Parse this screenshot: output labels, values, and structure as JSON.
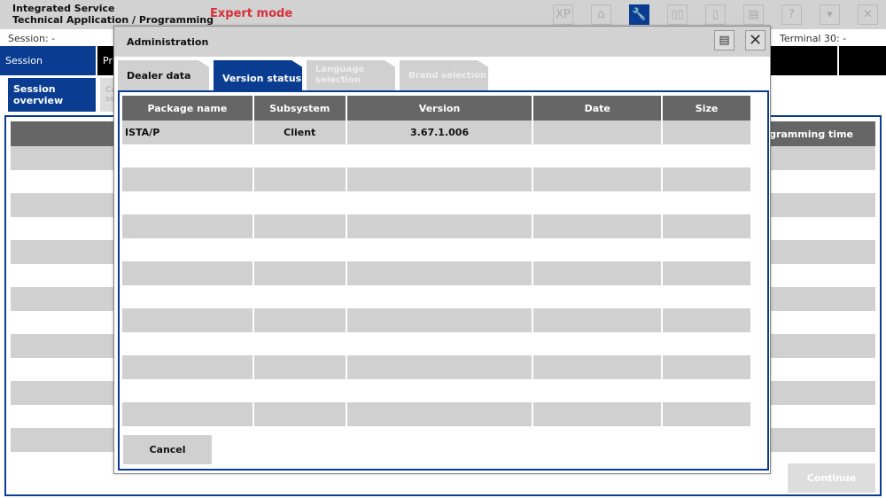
{
  "app": {
    "title_line1": "Integrated Service",
    "title_line2": "Technical Application / Programming",
    "mode": "Expert mode"
  },
  "toolbar": [
    {
      "icon": "xp-icon",
      "label": "XP"
    },
    {
      "icon": "home-icon",
      "label": "⌂"
    },
    {
      "icon": "wrench-icon",
      "label": "🔧"
    },
    {
      "icon": "compare-icon",
      "label": "▯▯"
    },
    {
      "icon": "battery-icon",
      "label": "▯"
    },
    {
      "icon": "printer-icon",
      "label": "▤"
    },
    {
      "icon": "help-icon",
      "label": "?"
    },
    {
      "icon": "minimize-icon",
      "label": "▾"
    },
    {
      "icon": "close-icon",
      "label": "✕"
    }
  ],
  "status": {
    "session": "Session:  -",
    "terminal": "Terminal 30:  -"
  },
  "nav": {
    "session": "Session",
    "second": "Pr"
  },
  "subtabs": {
    "overview": "Session overview",
    "second": "Ca se"
  },
  "background_table": {
    "last_header": "programming time"
  },
  "continue": "Continue",
  "modal": {
    "title": "Administration",
    "print": "▤",
    "close": "✕",
    "tabs": [
      "Dealer data",
      "Version status",
      "Language selection",
      "Brand selection"
    ],
    "columns": [
      "Package name",
      "Subsystem",
      "Version",
      "Date",
      "Size"
    ],
    "rows": [
      [
        "ISTA/P",
        "Client",
        "3.67.1.006",
        "",
        ""
      ]
    ],
    "cancel": "Cancel"
  }
}
